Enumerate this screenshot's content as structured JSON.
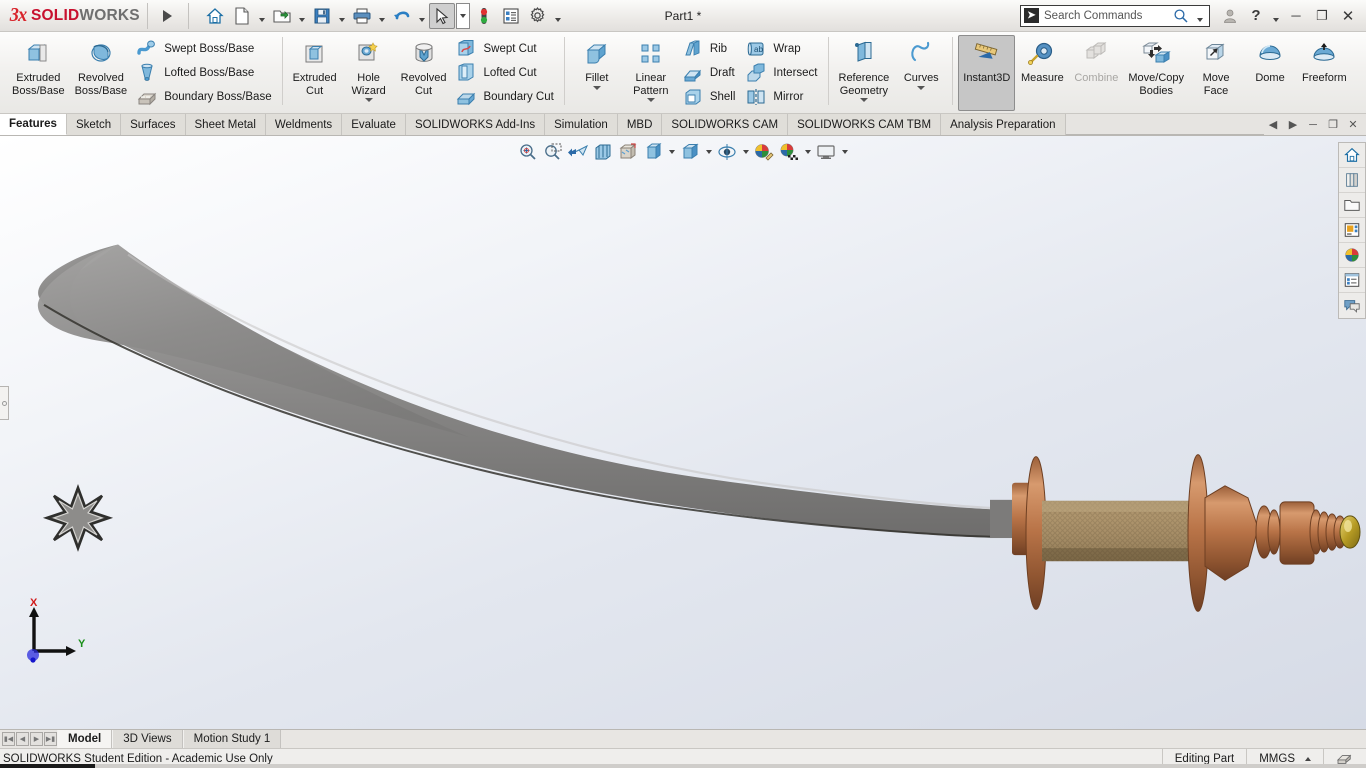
{
  "titlebar": {
    "brand_ds": "3S",
    "brand_solid": "SOLID",
    "brand_works": "WORKS",
    "document_title": "Part1 *",
    "quick_access": [
      {
        "name": "home-icon",
        "label": "Home"
      },
      {
        "name": "new-document-icon",
        "label": "New"
      },
      {
        "name": "open-folder-icon",
        "label": "Open"
      },
      {
        "name": "save-icon",
        "label": "Save"
      },
      {
        "name": "print-icon",
        "label": "Print"
      },
      {
        "name": "undo-icon",
        "label": "Undo"
      },
      {
        "name": "select-cursor-icon",
        "label": "Select"
      },
      {
        "name": "rebuild-icon",
        "label": "Rebuild"
      },
      {
        "name": "options-list-icon",
        "label": "File Properties"
      },
      {
        "name": "gear-icon",
        "label": "Options"
      }
    ],
    "search_placeholder": "Search Commands",
    "window_controls": [
      "minimize",
      "restore",
      "close"
    ]
  },
  "ribbon": {
    "groups": [
      {
        "name": "boss-base-group",
        "big": [
          {
            "label": "Extruded\nBoss/Base",
            "icon": "extruded-boss-icon"
          },
          {
            "label": "Revolved\nBoss/Base",
            "icon": "revolved-boss-icon"
          }
        ],
        "small": [
          {
            "label": "Swept Boss/Base",
            "icon": "swept-boss-icon"
          },
          {
            "label": "Lofted Boss/Base",
            "icon": "lofted-boss-icon"
          },
          {
            "label": "Boundary Boss/Base",
            "icon": "boundary-boss-icon"
          }
        ]
      },
      {
        "name": "cut-group",
        "big": [
          {
            "label": "Extruded\nCut",
            "icon": "extruded-cut-icon"
          },
          {
            "label": "Hole\nWizard",
            "icon": "hole-wizard-icon",
            "has_dropdown": true
          },
          {
            "label": "Revolved\nCut",
            "icon": "revolved-cut-icon"
          }
        ],
        "small": [
          {
            "label": "Swept Cut",
            "icon": "swept-cut-icon"
          },
          {
            "label": "Lofted Cut",
            "icon": "lofted-cut-icon"
          },
          {
            "label": "Boundary Cut",
            "icon": "boundary-cut-icon"
          }
        ]
      },
      {
        "name": "feature-group",
        "big": [
          {
            "label": "Fillet",
            "icon": "fillet-icon",
            "has_dropdown": true
          },
          {
            "label": "Linear\nPattern",
            "icon": "linear-pattern-icon",
            "has_dropdown": true
          }
        ],
        "small": [
          {
            "label": "Rib",
            "icon": "rib-icon"
          },
          {
            "label": "Draft",
            "icon": "draft-icon"
          },
          {
            "label": "Shell",
            "icon": "shell-icon"
          }
        ],
        "small2": [
          {
            "label": "Wrap",
            "icon": "wrap-icon"
          },
          {
            "label": "Intersect",
            "icon": "intersect-icon"
          },
          {
            "label": "Mirror",
            "icon": "mirror-icon"
          }
        ]
      },
      {
        "name": "reference-group",
        "big": [
          {
            "label": "Reference\nGeometry",
            "icon": "reference-geometry-icon",
            "has_dropdown": true
          },
          {
            "label": "Curves",
            "icon": "curves-icon",
            "has_dropdown": true
          }
        ]
      },
      {
        "name": "tools-group",
        "big": [
          {
            "label": "Instant3D",
            "icon": "instant3d-icon",
            "active": true
          },
          {
            "label": "Measure",
            "icon": "measure-icon"
          },
          {
            "label": "Combine",
            "icon": "combine-icon",
            "disabled": true
          },
          {
            "label": "Move/Copy\nBodies",
            "icon": "move-copy-bodies-icon"
          },
          {
            "label": "Move\nFace",
            "icon": "move-face-icon"
          },
          {
            "label": "Dome",
            "icon": "dome-icon"
          },
          {
            "label": "Freeform",
            "icon": "freeform-icon"
          }
        ]
      }
    ]
  },
  "command_tabs": {
    "items": [
      {
        "label": "Features",
        "active": true
      },
      {
        "label": "Sketch",
        "active": false
      },
      {
        "label": "Surfaces",
        "active": false
      },
      {
        "label": "Sheet Metal",
        "active": false
      },
      {
        "label": "Weldments",
        "active": false
      },
      {
        "label": "Evaluate",
        "active": false
      },
      {
        "label": "SOLIDWORKS Add-Ins",
        "active": false
      },
      {
        "label": "Simulation",
        "active": false
      },
      {
        "label": "MBD",
        "active": false
      },
      {
        "label": "SOLIDWORKS CAM",
        "active": false
      },
      {
        "label": "SOLIDWORKS CAM TBM",
        "active": false
      },
      {
        "label": "Analysis Preparation",
        "active": false
      }
    ],
    "window_controls": [
      "prev",
      "next",
      "minimize",
      "restore",
      "close"
    ]
  },
  "view_toolbar": {
    "items": [
      {
        "name": "zoom-to-fit-icon",
        "label": "Zoom to Fit"
      },
      {
        "name": "zoom-to-area-icon",
        "label": "Zoom to Area"
      },
      {
        "name": "previous-view-icon",
        "label": "Previous View"
      },
      {
        "name": "section-view-icon",
        "label": "Section View"
      },
      {
        "name": "view-orientation-icon",
        "label": "View Orientation"
      },
      {
        "name": "display-style-icon",
        "label": "Display Style",
        "has_dropdown": true
      },
      {
        "name": "hide-show-items-icon",
        "label": "Hide/Show Items",
        "has_dropdown": true
      },
      {
        "name": "edit-appearance-icon",
        "label": "Edit Appearance",
        "has_dropdown": true
      },
      {
        "name": "apply-scene-icon",
        "label": "Apply Scene",
        "has_dropdown": true
      },
      {
        "name": "view-settings-icon",
        "label": "View Settings",
        "has_dropdown": true
      }
    ]
  },
  "task_panel": {
    "items": [
      {
        "name": "solidworks-resources-icon",
        "label": "SOLIDWORKS Resources"
      },
      {
        "name": "design-library-icon",
        "label": "Design Library"
      },
      {
        "name": "file-explorer-icon",
        "label": "File Explorer"
      },
      {
        "name": "view-palette-icon",
        "label": "View Palette"
      },
      {
        "name": "appearances-scenes-icon",
        "label": "Appearances, Scenes and Decals"
      },
      {
        "name": "custom-properties-icon",
        "label": "Custom Properties"
      },
      {
        "name": "forum-icon",
        "label": "SOLIDWORKS Forum"
      }
    ]
  },
  "triad": {
    "x_label": "X",
    "y_label": "Y",
    "x_color": "#d11a1a",
    "y_color": "#1a8f1a",
    "z_color": "#1a1ad1"
  },
  "model": {
    "description": "Curved sword / shamshir blade with 8-pointed star cutout and copper handle",
    "blade_color": "#8e8d8c",
    "handle_color": "#b5764a",
    "grip_color": "#a88355",
    "pommel_color": "#c9a227"
  },
  "bottom_tabs": {
    "nav_buttons": [
      "first",
      "previous",
      "next",
      "last"
    ],
    "items": [
      {
        "label": "Model",
        "active": true
      },
      {
        "label": "3D Views",
        "active": false
      },
      {
        "label": "Motion Study 1",
        "active": false
      }
    ]
  },
  "status_bar": {
    "license_text": "SOLIDWORKS Student Edition - Academic Use Only",
    "edit_mode": "Editing Part",
    "units": "MMGS",
    "overlay_icon": "overlay-icon"
  }
}
